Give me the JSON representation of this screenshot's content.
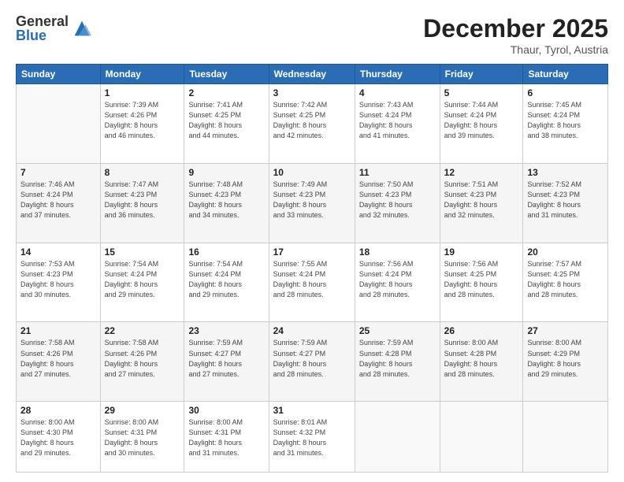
{
  "header": {
    "logo_general": "General",
    "logo_blue": "Blue",
    "month": "December 2025",
    "location": "Thaur, Tyrol, Austria"
  },
  "days_of_week": [
    "Sunday",
    "Monday",
    "Tuesday",
    "Wednesday",
    "Thursday",
    "Friday",
    "Saturday"
  ],
  "weeks": [
    [
      {
        "day": "",
        "info": ""
      },
      {
        "day": "1",
        "info": "Sunrise: 7:39 AM\nSunset: 4:26 PM\nDaylight: 8 hours\nand 46 minutes."
      },
      {
        "day": "2",
        "info": "Sunrise: 7:41 AM\nSunset: 4:25 PM\nDaylight: 8 hours\nand 44 minutes."
      },
      {
        "day": "3",
        "info": "Sunrise: 7:42 AM\nSunset: 4:25 PM\nDaylight: 8 hours\nand 42 minutes."
      },
      {
        "day": "4",
        "info": "Sunrise: 7:43 AM\nSunset: 4:24 PM\nDaylight: 8 hours\nand 41 minutes."
      },
      {
        "day": "5",
        "info": "Sunrise: 7:44 AM\nSunset: 4:24 PM\nDaylight: 8 hours\nand 39 minutes."
      },
      {
        "day": "6",
        "info": "Sunrise: 7:45 AM\nSunset: 4:24 PM\nDaylight: 8 hours\nand 38 minutes."
      }
    ],
    [
      {
        "day": "7",
        "info": "Sunrise: 7:46 AM\nSunset: 4:24 PM\nDaylight: 8 hours\nand 37 minutes."
      },
      {
        "day": "8",
        "info": "Sunrise: 7:47 AM\nSunset: 4:23 PM\nDaylight: 8 hours\nand 36 minutes."
      },
      {
        "day": "9",
        "info": "Sunrise: 7:48 AM\nSunset: 4:23 PM\nDaylight: 8 hours\nand 34 minutes."
      },
      {
        "day": "10",
        "info": "Sunrise: 7:49 AM\nSunset: 4:23 PM\nDaylight: 8 hours\nand 33 minutes."
      },
      {
        "day": "11",
        "info": "Sunrise: 7:50 AM\nSunset: 4:23 PM\nDaylight: 8 hours\nand 32 minutes."
      },
      {
        "day": "12",
        "info": "Sunrise: 7:51 AM\nSunset: 4:23 PM\nDaylight: 8 hours\nand 32 minutes."
      },
      {
        "day": "13",
        "info": "Sunrise: 7:52 AM\nSunset: 4:23 PM\nDaylight: 8 hours\nand 31 minutes."
      }
    ],
    [
      {
        "day": "14",
        "info": "Sunrise: 7:53 AM\nSunset: 4:23 PM\nDaylight: 8 hours\nand 30 minutes."
      },
      {
        "day": "15",
        "info": "Sunrise: 7:54 AM\nSunset: 4:24 PM\nDaylight: 8 hours\nand 29 minutes."
      },
      {
        "day": "16",
        "info": "Sunrise: 7:54 AM\nSunset: 4:24 PM\nDaylight: 8 hours\nand 29 minutes."
      },
      {
        "day": "17",
        "info": "Sunrise: 7:55 AM\nSunset: 4:24 PM\nDaylight: 8 hours\nand 28 minutes."
      },
      {
        "day": "18",
        "info": "Sunrise: 7:56 AM\nSunset: 4:24 PM\nDaylight: 8 hours\nand 28 minutes."
      },
      {
        "day": "19",
        "info": "Sunrise: 7:56 AM\nSunset: 4:25 PM\nDaylight: 8 hours\nand 28 minutes."
      },
      {
        "day": "20",
        "info": "Sunrise: 7:57 AM\nSunset: 4:25 PM\nDaylight: 8 hours\nand 28 minutes."
      }
    ],
    [
      {
        "day": "21",
        "info": "Sunrise: 7:58 AM\nSunset: 4:26 PM\nDaylight: 8 hours\nand 27 minutes."
      },
      {
        "day": "22",
        "info": "Sunrise: 7:58 AM\nSunset: 4:26 PM\nDaylight: 8 hours\nand 27 minutes."
      },
      {
        "day": "23",
        "info": "Sunrise: 7:59 AM\nSunset: 4:27 PM\nDaylight: 8 hours\nand 27 minutes."
      },
      {
        "day": "24",
        "info": "Sunrise: 7:59 AM\nSunset: 4:27 PM\nDaylight: 8 hours\nand 28 minutes."
      },
      {
        "day": "25",
        "info": "Sunrise: 7:59 AM\nSunset: 4:28 PM\nDaylight: 8 hours\nand 28 minutes."
      },
      {
        "day": "26",
        "info": "Sunrise: 8:00 AM\nSunset: 4:28 PM\nDaylight: 8 hours\nand 28 minutes."
      },
      {
        "day": "27",
        "info": "Sunrise: 8:00 AM\nSunset: 4:29 PM\nDaylight: 8 hours\nand 29 minutes."
      }
    ],
    [
      {
        "day": "28",
        "info": "Sunrise: 8:00 AM\nSunset: 4:30 PM\nDaylight: 8 hours\nand 29 minutes."
      },
      {
        "day": "29",
        "info": "Sunrise: 8:00 AM\nSunset: 4:31 PM\nDaylight: 8 hours\nand 30 minutes."
      },
      {
        "day": "30",
        "info": "Sunrise: 8:00 AM\nSunset: 4:31 PM\nDaylight: 8 hours\nand 31 minutes."
      },
      {
        "day": "31",
        "info": "Sunrise: 8:01 AM\nSunset: 4:32 PM\nDaylight: 8 hours\nand 31 minutes."
      },
      {
        "day": "",
        "info": ""
      },
      {
        "day": "",
        "info": ""
      },
      {
        "day": "",
        "info": ""
      }
    ]
  ]
}
